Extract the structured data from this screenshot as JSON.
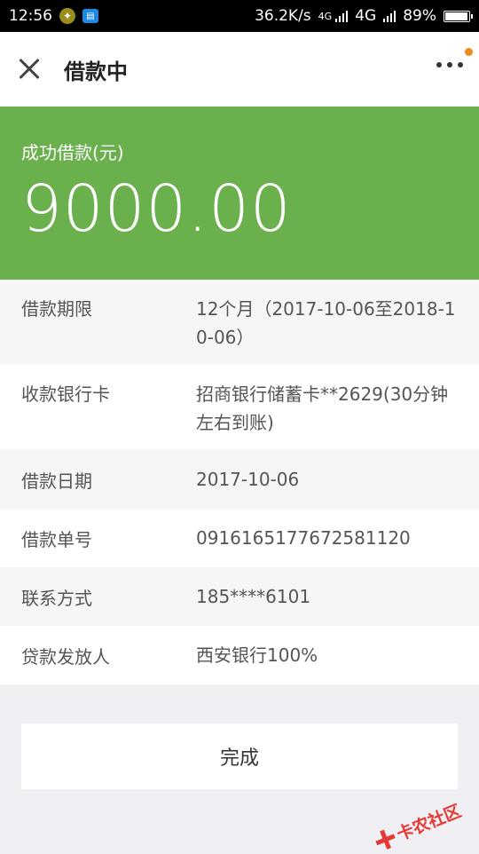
{
  "status_bar": {
    "time": "12:56",
    "network_speed": "36.2K/s",
    "signal_net_1": "4G",
    "signal_label_2": "4G",
    "battery_percent": "89%",
    "battery_level": 0.89
  },
  "header": {
    "title": "借款中"
  },
  "hero": {
    "label": "成功借款(元)",
    "amount": "9000.00",
    "background": "#6ab04c"
  },
  "details": [
    {
      "label": "借款期限",
      "value": "12个月（2017-10-06至2018-10-06）"
    },
    {
      "label": "收款银行卡",
      "value": "招商银行储蓄卡**2629(30分钟左右到账)"
    },
    {
      "label": "借款日期",
      "value": "2017-10-06"
    },
    {
      "label": "借款单号",
      "value": "0916165177672581120"
    },
    {
      "label": "联系方式",
      "value": "185****6101"
    },
    {
      "label": "贷款发放人",
      "value": "西安银行100%"
    }
  ],
  "actions": {
    "done_label": "完成"
  },
  "watermark": {
    "text": "卡农社区"
  }
}
